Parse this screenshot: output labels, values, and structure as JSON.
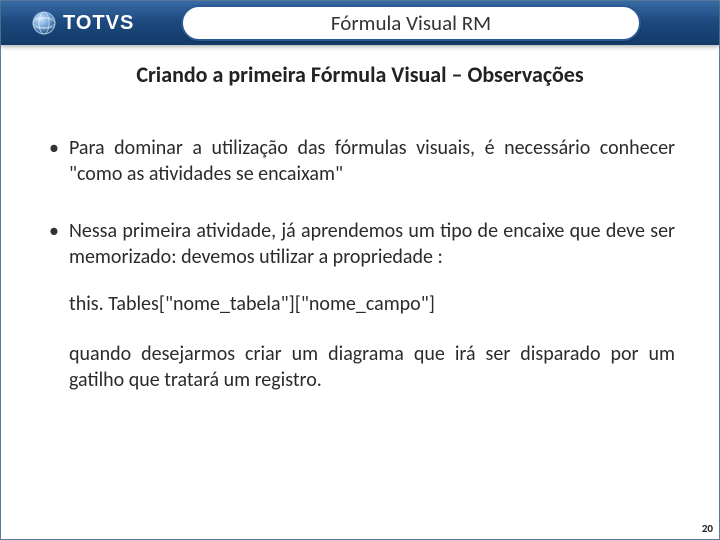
{
  "header": {
    "brand": "TOTVS",
    "title": "Fórmula Visual RM"
  },
  "subtitle": "Criando a primeira Fórmula Visual  – Observações",
  "bullets": [
    "Para dominar a utilização das fórmulas visuais, é necessário conhecer \"como as atividades se encaixam\"",
    "Nessa primeira atividade, já aprendemos um tipo de encaixe que deve ser memorizado:  devemos utilizar a propriedade :"
  ],
  "code_line": "this. Tables[\"nome_tabela\"][\"nome_campo\"]",
  "tail_paragraph": "quando desejarmos criar um diagrama que irá ser disparado por um gatilho que tratará um registro.",
  "page_number": "20"
}
